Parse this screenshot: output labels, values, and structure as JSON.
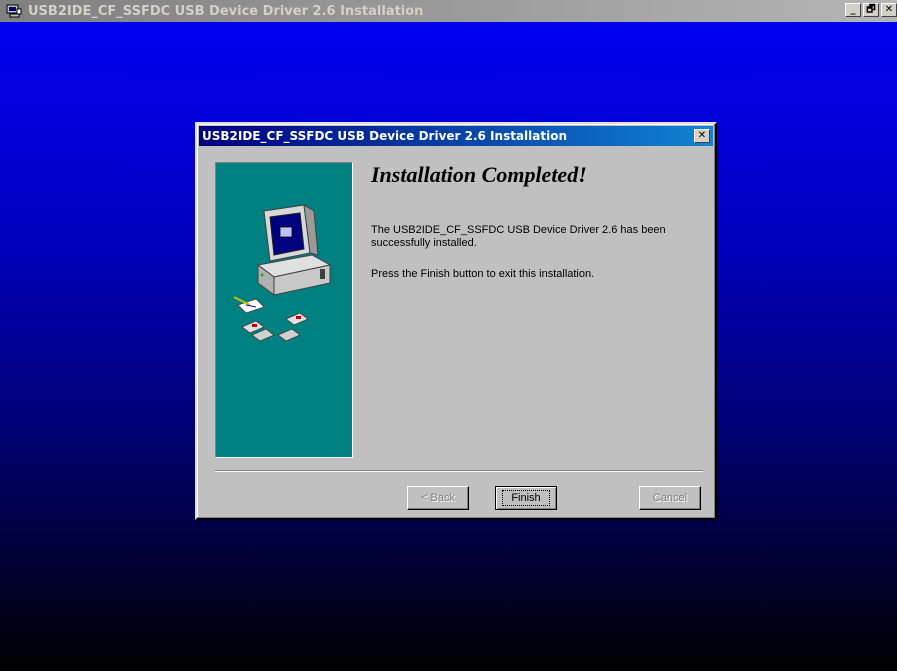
{
  "outer_window": {
    "title": "USB2IDE_CF_SSFDC USB Device Driver 2.6 Installation",
    "controls": {
      "minimize": "_",
      "restore": "🗗",
      "close": "✕"
    }
  },
  "dialog": {
    "title": "USB2IDE_CF_SSFDC USB Device Driver 2.6 Installation",
    "close_label": "✕",
    "heading": "Installation Completed!",
    "message": "The USB2IDE_CF_SSFDC USB Device Driver 2.6 has been successfully installed.",
    "instruction": "Press the Finish button to exit this installation.",
    "buttons": {
      "back": "< Back",
      "finish": "Finish",
      "cancel": "Cancel"
    }
  },
  "colors": {
    "desktop_top": "#0000f4",
    "desktop_bottom": "#000000",
    "dialog_face": "#c0c0c0",
    "title_active": "#000080",
    "side_panel": "#008080"
  },
  "icons": {
    "app": "setup-icon",
    "illustration": "computer-with-disks-icon"
  }
}
